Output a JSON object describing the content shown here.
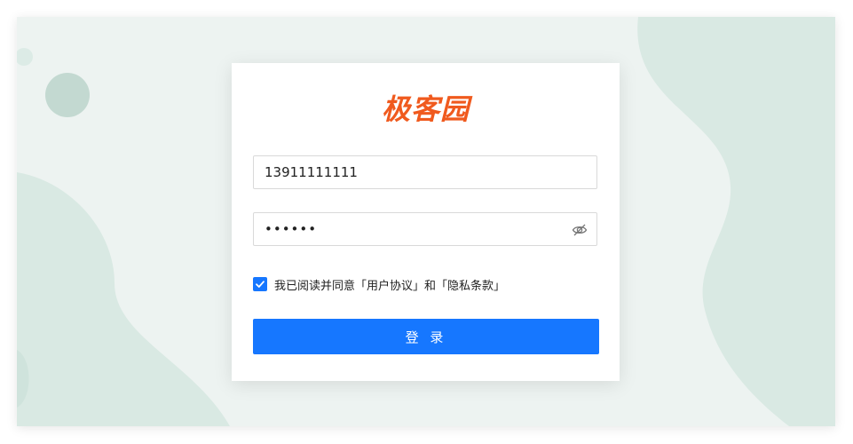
{
  "brand": {
    "logo_text": "极客园",
    "logo_color": "#f05a1e"
  },
  "form": {
    "phone_value": "13911111111",
    "password_value": "******",
    "password_toggle_icon": "eye-off-icon",
    "agreement_checked": true,
    "agreement_text": "我已阅读并同意「用户协议」和「隐私条款」",
    "login_label": "登 录"
  },
  "colors": {
    "accent": "#1677ff",
    "background": "#edf3f1",
    "decor_shape": "#d9e9e3",
    "decor_circle": "#c3d9d1"
  }
}
